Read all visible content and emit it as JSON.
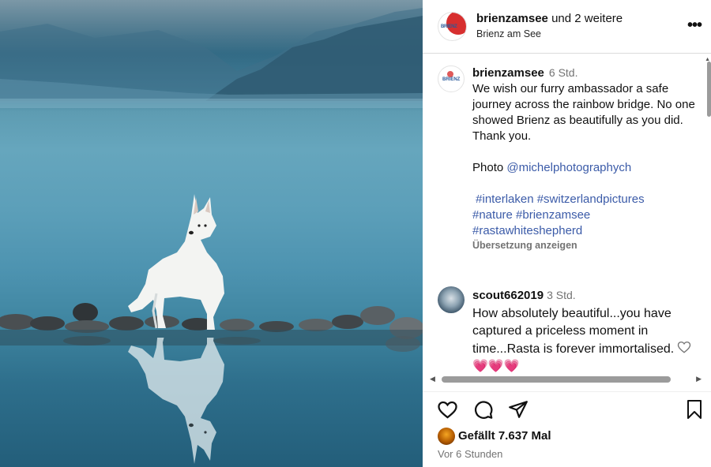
{
  "post": {
    "photo_alt": "",
    "header": {
      "username": "brienzamsee",
      "coauthors": "und 2 weitere",
      "location": "Brienz am See",
      "more_icon": "more-horizontal-icon"
    },
    "caption": {
      "username": "brienzamsee",
      "time": "6 Std.",
      "line1": "We wish our furry ambassador a safe journey across the rainbow bridge. No one showed Brienz as beautifully as you did.",
      "line2": "Thank you.",
      "photo_label": "Photo",
      "photo_mention": "@michelphotographych",
      "hashtags_line1": " #interlaken #switzerlandpictures",
      "hashtags_line2": "#nature #brienzamsee",
      "hashtags_line3": "#rastawhiteshepherd",
      "translate": "Übersetzung anzeigen"
    },
    "comment": {
      "username": "scout662019",
      "time": "3 Std.",
      "text": "How absolutely beautiful...you have captured a priceless moment in time...Rasta is forever immortalised.",
      "emoji": "💗💗💗"
    },
    "likes": "Gefällt 7.637 Mal",
    "timestamp": "Vor 6 Stunden",
    "colors": {
      "link": "#3b5ba8",
      "muted": "#737373",
      "heart_emoji": "#e8336b"
    }
  }
}
